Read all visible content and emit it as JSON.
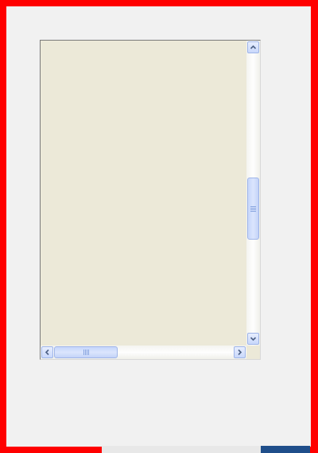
{
  "scroll_pane": {
    "vertical_scroll_position": 0.57,
    "horizontal_scroll_position": 0.0,
    "icons": {
      "up": "chevron-up-icon",
      "down": "chevron-down-icon",
      "left": "chevron-left-icon",
      "right": "chevron-right-icon"
    }
  },
  "colors": {
    "frame": "#ff0000",
    "panel": "#f1f1f1",
    "content": "#ece9d8",
    "scrollbar_accent": "#c6d6fb"
  }
}
